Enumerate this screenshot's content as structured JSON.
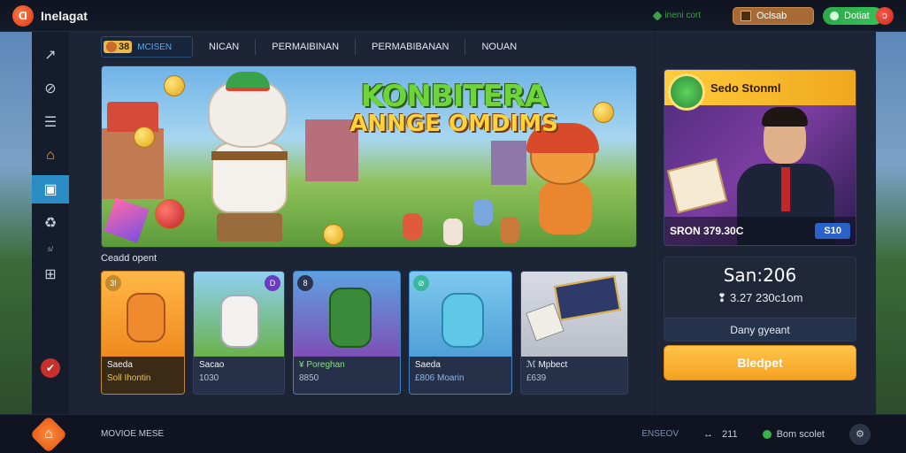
{
  "app": {
    "title": "Inelagat",
    "logo_letter": "Ɑ"
  },
  "topbar": {
    "coin_text": "ineni cort",
    "brown_button": "Oclsab",
    "green_button": "Dotiat",
    "badge_symbol": "ɔ"
  },
  "sidebar": {
    "items": [
      {
        "icon": "↗",
        "name": "sidebar-item-1"
      },
      {
        "icon": "⊘",
        "name": "sidebar-item-2"
      },
      {
        "icon": "☰",
        "name": "sidebar-item-3"
      },
      {
        "icon": "⌂",
        "name": "sidebar-item-4"
      },
      {
        "icon": "▣",
        "name": "sidebar-item-5"
      },
      {
        "icon": "♻",
        "name": "sidebar-item-6"
      },
      {
        "icon": "s/",
        "name": "sidebar-item-7"
      },
      {
        "icon": "⊞",
        "name": "sidebar-item-8"
      }
    ],
    "bottom_icon": "✔"
  },
  "tabs": {
    "first_badge": "38",
    "first_label": "MCISEN",
    "items": [
      "NICAN",
      "PERMAIBINAN",
      "PERMABIBANAN",
      "NOUAN"
    ]
  },
  "hero": {
    "title_line1": "KONBITERA",
    "title_line2": "ANNGE OMDIMS"
  },
  "section_label": "Ceadd opent",
  "cards": [
    {
      "badge": "3!",
      "name": "Saeda",
      "sub": "Soll Ihontin"
    },
    {
      "badge": "D",
      "name": "Sacao",
      "sub": "1030"
    },
    {
      "badge": "8",
      "name": "¥ Poreghan",
      "sub": "8850"
    },
    {
      "badge": "⊘",
      "name": "Saeda",
      "sub": "£806 Moarin"
    },
    {
      "badge": "",
      "name": "ℳ Mpbect",
      "sub": "£639"
    }
  ],
  "promo": {
    "title": "Sedo Stonml",
    "amount": "SRON 379.30C",
    "button": "S10"
  },
  "stats": {
    "big": "San:206",
    "small": "❢ 3.27 230c1om",
    "row": "Dany gyeant"
  },
  "cta_label": "Bledpet",
  "bottombar": {
    "left_text": "MOVIOE MESE",
    "item1": "ENSEOV",
    "item2_icon": "↔",
    "item2": "211",
    "item3": "Bom scolet"
  }
}
